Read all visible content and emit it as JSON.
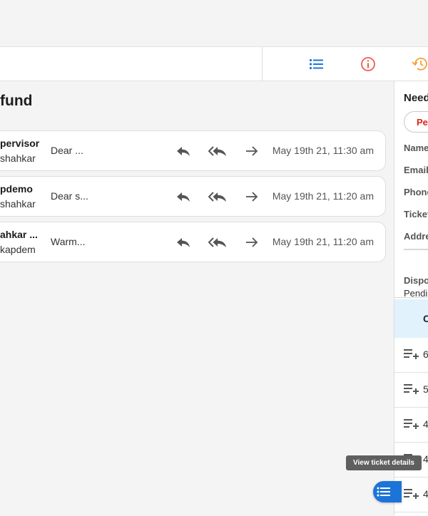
{
  "colors": {
    "accent_blue": "#1d74d8",
    "info_red": "#f15a4d",
    "history_orange": "#f5a13a",
    "pending_red": "#d9241b",
    "header_blue_bg": "#e1f2fd"
  },
  "subbar": {
    "icons": [
      "list-icon",
      "info-icon",
      "history-icon"
    ]
  },
  "main": {
    "title": "fund",
    "threads": [
      {
        "sender": "pervisor",
        "recipient": "shahkar",
        "preview": "Dear ...",
        "time": "May 19th 21, 11:30 am"
      },
      {
        "sender": "pdemo",
        "recipient": "shahkar",
        "preview": "Dear s...",
        "time": "May 19th 21, 11:20 am"
      },
      {
        "sender": "ahkar ...",
        "recipient": "kapdem",
        "preview": "Warm...",
        "time": "May 19th 21, 11:20 am"
      }
    ],
    "row_action_icons": [
      "reply-icon",
      "reply-all-icon",
      "forward-icon"
    ]
  },
  "right_panel": {
    "title": "Need",
    "status_pill": "Pen",
    "fields": [
      {
        "label": "Name"
      },
      {
        "label": "Email"
      },
      {
        "label": "Phone"
      },
      {
        "label": "Ticket"
      },
      {
        "label": "Addre"
      }
    ],
    "disposition_label": "Dispos",
    "disposition_value": "Pendi",
    "list_header": "C",
    "list_items": [
      "6",
      "5",
      "4",
      "4",
      "4"
    ]
  },
  "tooltip": "View ticket details"
}
